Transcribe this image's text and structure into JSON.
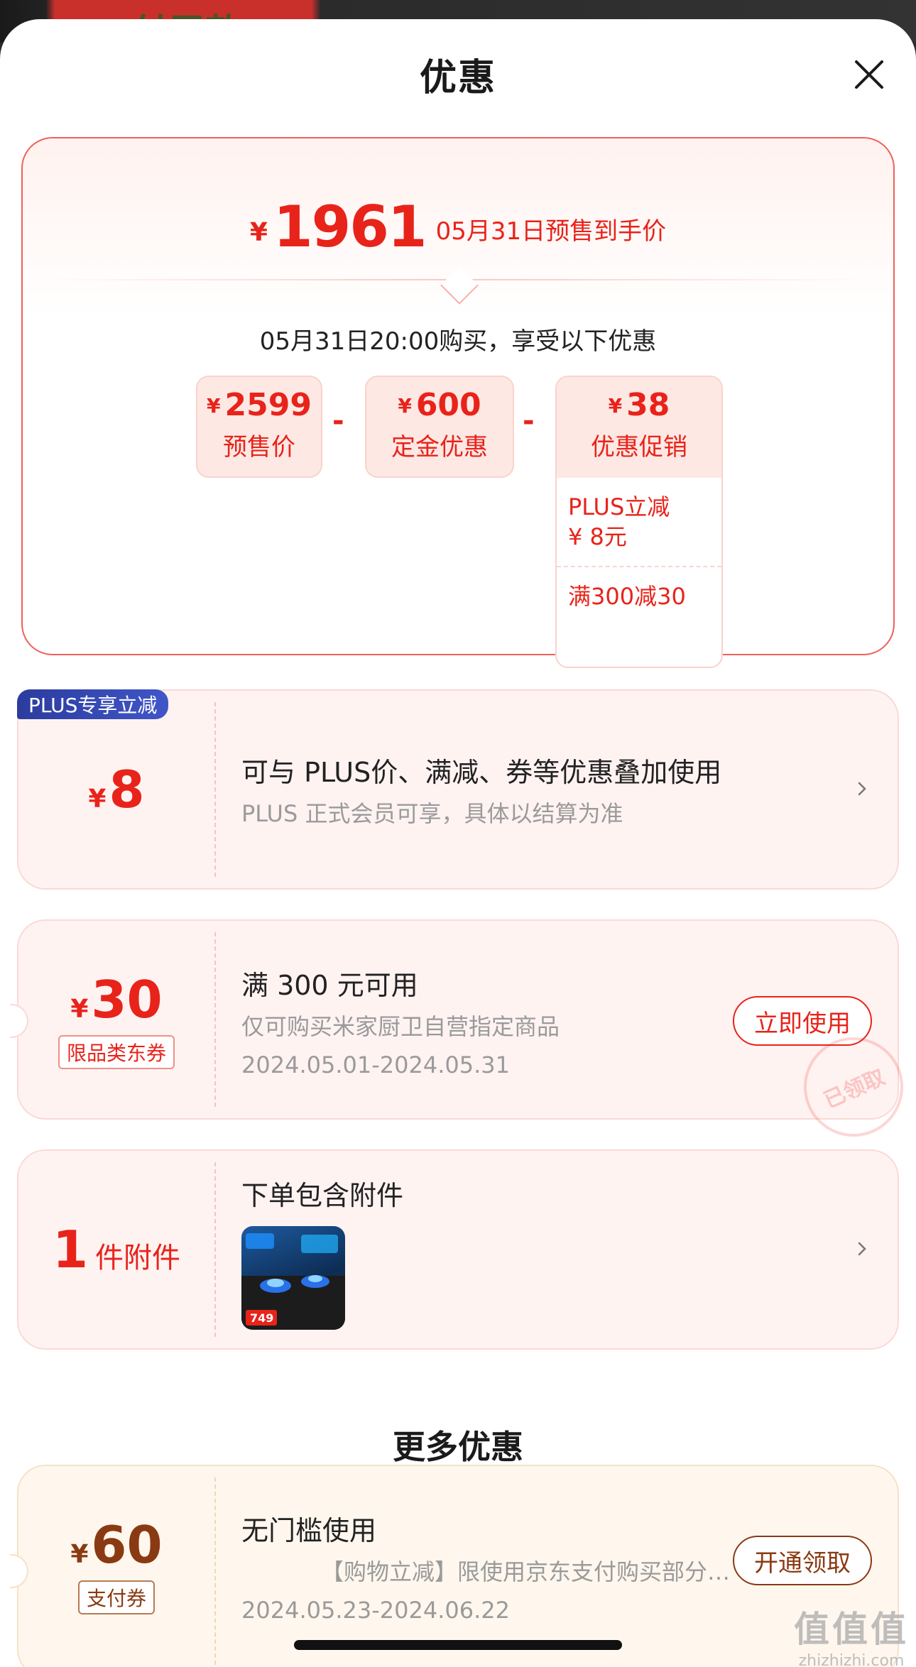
{
  "background": {
    "text": "付尾款"
  },
  "header": {
    "title": "优惠",
    "close_icon": "close-icon"
  },
  "summary": {
    "currency": "¥",
    "final_price": "1961",
    "final_label": "05月31日预售到手价",
    "buy_note": "05月31日20:00购买，享受以下优惠",
    "presale": {
      "currency": "¥",
      "value": "2599",
      "label": "预售价"
    },
    "minus_sign": "-",
    "deposit": {
      "currency": "¥",
      "value": "600",
      "label": "定金优惠"
    },
    "promo": {
      "currency": "¥",
      "value": "38",
      "label": "优惠促销",
      "items": [
        "PLUS立减\n¥ 8元",
        "满300减30"
      ]
    }
  },
  "plus_coupon": {
    "badge": "PLUS专享立减",
    "currency": "¥",
    "amount": "8",
    "title": "可与 PLUS价、满减、券等优惠叠加使用",
    "desc": "PLUS 正式会员可享，具体以结算为准",
    "chevron_icon": "chevron-right-icon"
  },
  "jd_coupon": {
    "currency": "¥",
    "amount": "30",
    "tag": "限品类东券",
    "title": "满 300 元可用",
    "desc": "仅可购买米家厨卫自营指定商品",
    "date": "2024.05.01-2024.05.31",
    "button": "立即使用",
    "stamp": "已领取"
  },
  "accessory": {
    "count": "1",
    "unit": "件附件",
    "title": "下单包含附件",
    "thumb_price": "749",
    "chevron_icon": "chevron-right-icon"
  },
  "more": {
    "title": "更多优惠",
    "pay_coupon": {
      "currency": "¥",
      "amount": "60",
      "tag": "支付券",
      "title": "无门槛使用",
      "desc": "【购物立减】限使用京东支付购买部分…",
      "date": "2024.05.23-2024.06.22",
      "button": "开通领取"
    }
  },
  "watermark": {
    "line1": "值值值",
    "line2": "zhizhizhi.com"
  },
  "colors": {
    "accent": "#e8231a",
    "plus_blue": "#2b3c9e",
    "gold": "#8a3a12"
  }
}
